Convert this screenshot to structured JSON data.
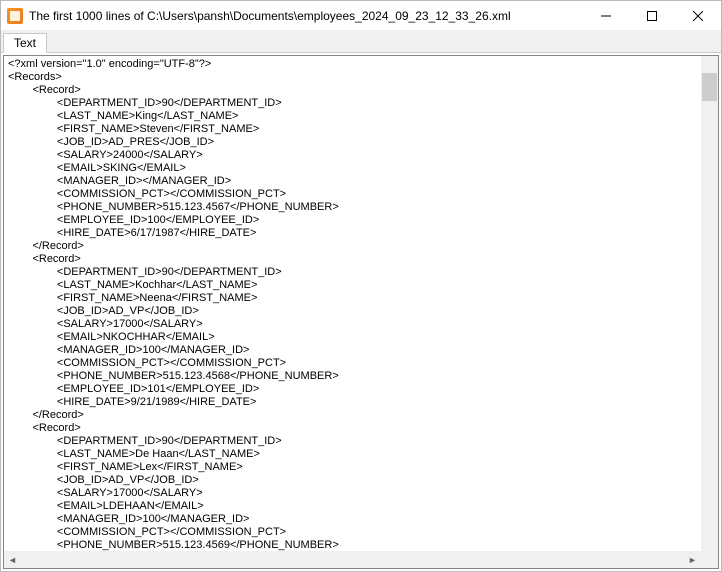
{
  "window": {
    "title": "The first 1000 lines of C:\\Users\\pansh\\Documents\\employees_2024_09_23_12_33_26.xml"
  },
  "tabs": {
    "text": "Text"
  },
  "xml": {
    "declaration": "<?xml version=\"1.0\" encoding=\"UTF-8\"?>",
    "root_open": "<Records>",
    "record_open": "<Record>",
    "record_close": "</Record>",
    "records": [
      {
        "DEPARTMENT_ID": "90",
        "LAST_NAME": "King",
        "FIRST_NAME": "Steven",
        "JOB_ID": "AD_PRES",
        "SALARY": "24000",
        "EMAIL": "SKING",
        "MANAGER_ID": "",
        "COMMISSION_PCT": "",
        "PHONE_NUMBER": "515.123.4567",
        "EMPLOYEE_ID": "100",
        "HIRE_DATE": "6/17/1987"
      },
      {
        "DEPARTMENT_ID": "90",
        "LAST_NAME": "Kochhar",
        "FIRST_NAME": "Neena",
        "JOB_ID": "AD_VP",
        "SALARY": "17000",
        "EMAIL": "NKOCHHAR",
        "MANAGER_ID": "100",
        "COMMISSION_PCT": "",
        "PHONE_NUMBER": "515.123.4568",
        "EMPLOYEE_ID": "101",
        "HIRE_DATE": "9/21/1989"
      },
      {
        "DEPARTMENT_ID": "90",
        "LAST_NAME": "De Haan",
        "FIRST_NAME": "Lex",
        "JOB_ID": "AD_VP",
        "SALARY": "17000",
        "EMAIL": "LDEHAAN",
        "MANAGER_ID": "100",
        "COMMISSION_PCT": "",
        "PHONE_NUMBER": "515.123.4569"
      }
    ],
    "field_order_full": [
      "DEPARTMENT_ID",
      "LAST_NAME",
      "FIRST_NAME",
      "JOB_ID",
      "SALARY",
      "EMAIL",
      "MANAGER_ID",
      "COMMISSION_PCT",
      "PHONE_NUMBER",
      "EMPLOYEE_ID",
      "HIRE_DATE"
    ],
    "field_order_rec1": [
      "DEPARTMENT_ID",
      "LAST_NAME",
      "FIRST_NAME",
      "JOB_ID",
      "SALARY",
      "EMAIL",
      "MANAGER_ID",
      "COMMISSION_PCT",
      "PHONE_NUMBER",
      "EMPLOYEE_ID",
      "HIRE_DATE"
    ],
    "last_visible_fields": [
      "DEPARTMENT_ID",
      "LAST_NAME",
      "FIRST_NAME",
      "JOB_ID",
      "SALARY",
      "EMAIL",
      "MANAGER_ID",
      "COMMISSION_PCT",
      "PHONE_NUMBER"
    ]
  }
}
